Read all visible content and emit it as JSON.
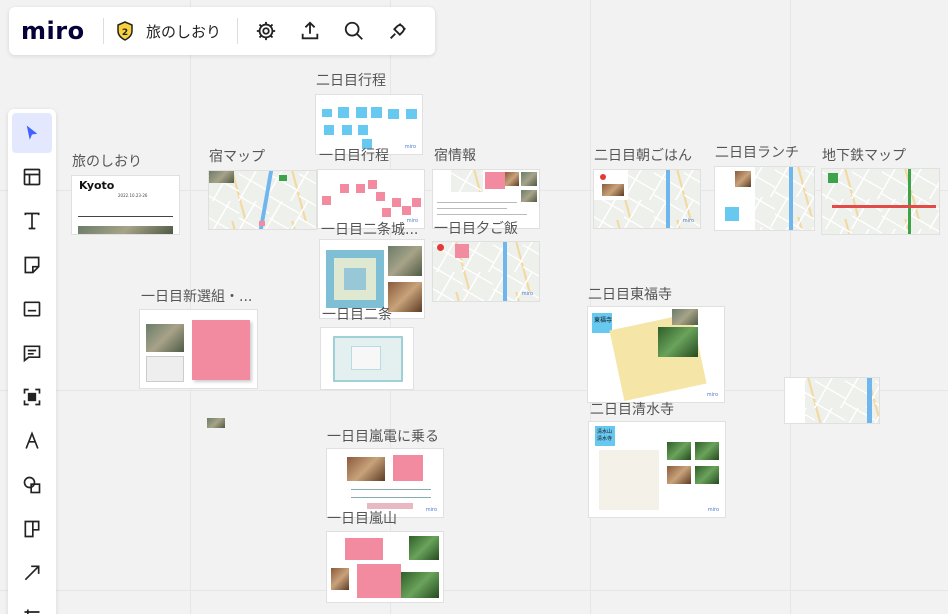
{
  "app": {
    "logo_text": "miro",
    "board_title": "旅のしおり",
    "badge_count": "2",
    "accent_color": "#4262ff",
    "logo_color": "#050038"
  },
  "top_toolbar": [
    {
      "name": "settings-icon"
    },
    {
      "name": "upload-icon"
    },
    {
      "name": "search-icon"
    },
    {
      "name": "plug-icon"
    }
  ],
  "left_toolbar": [
    {
      "name": "select-cursor-icon",
      "active": true
    },
    {
      "name": "templates-icon"
    },
    {
      "name": "text-icon"
    },
    {
      "name": "sticky-note-icon"
    },
    {
      "name": "card-icon"
    },
    {
      "name": "comment-icon"
    },
    {
      "name": "frame-icon"
    },
    {
      "name": "pen-icon"
    },
    {
      "name": "shapes-icon"
    },
    {
      "name": "kanban-icon"
    },
    {
      "name": "connection-line-icon"
    },
    {
      "name": "more-tools-icon"
    }
  ],
  "frames": {
    "shiori": {
      "label": "旅のしおり",
      "title": "Kyoto",
      "date": "2022.10.23-26"
    },
    "yado_map": {
      "label": "宿マップ"
    },
    "day2_itinerary": {
      "label": "二日目行程"
    },
    "day1_itinerary": {
      "label": "一日目行程"
    },
    "yado_info": {
      "label": "宿情報"
    },
    "day1_nijo_castle": {
      "label": "一日目二条城..."
    },
    "day1_dinner": {
      "label": "一日目夕ご飯"
    },
    "day1_shinsengumi": {
      "label": "一日目新選組・..."
    },
    "day1_nijo": {
      "label": "一日目二条"
    },
    "day1_randen": {
      "label": "一日目嵐電に乗る"
    },
    "day1_arashiyama": {
      "label": "一日目嵐山"
    },
    "day2_breakfast": {
      "label": "二日目朝ごはん"
    },
    "day2_lunch": {
      "label": "二日目ランチ"
    },
    "subway_map": {
      "label": "地下鉄マップ"
    },
    "day2_tofukuji": {
      "label": "二日目東福寺",
      "sticky": "東福寺"
    },
    "day2_kiyomizu": {
      "label": "二日目清水寺",
      "sticky": "清水山\n清水寺"
    }
  }
}
